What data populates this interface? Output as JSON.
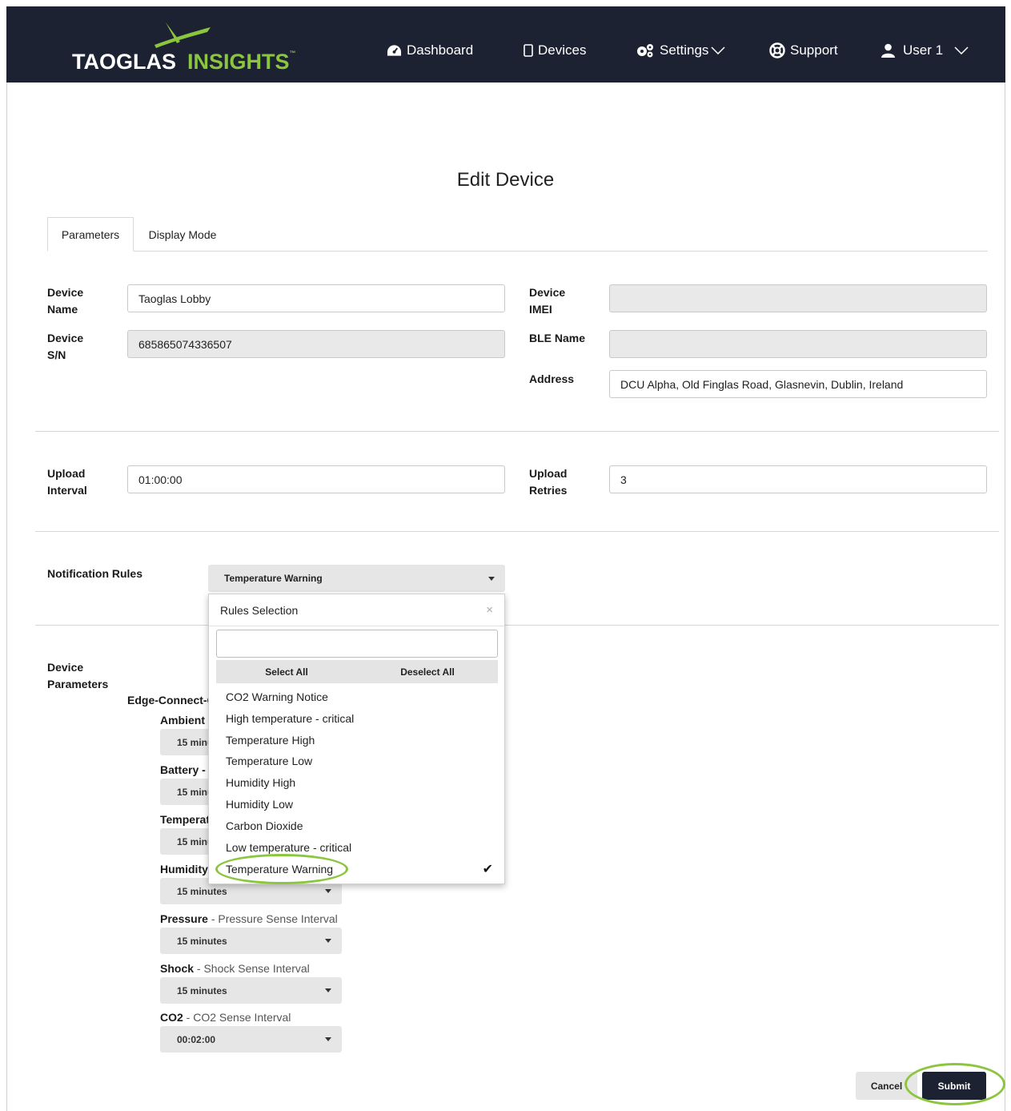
{
  "brand": {
    "name_part1": "TAOGLAS",
    "name_part2": "INSIGHTS",
    "trademark": "™",
    "primary_color": "#1c2231",
    "accent_color": "#8cc63f"
  },
  "nav": {
    "dashboard": "Dashboard",
    "devices": "Devices",
    "settings": "Settings",
    "support": "Support",
    "user": "User 1"
  },
  "page_title": "Edit Device",
  "tabs": {
    "parameters": "Parameters",
    "display_mode": "Display Mode"
  },
  "fields": {
    "device_name_label_1": "Device",
    "device_name_label_2": "Name",
    "device_name_value": "Taoglas Lobby",
    "device_sn_label_1": "Device",
    "device_sn_label_2": "S/N",
    "device_sn_value": "685865074336507",
    "device_imei_label_1": "Device",
    "device_imei_label_2": "IMEI",
    "device_imei_value": "",
    "ble_name_label": "BLE Name",
    "ble_name_value": "",
    "address_label": "Address",
    "address_value": "DCU Alpha, Old Finglas Road, Glasnevin, Dublin, Ireland",
    "upload_interval_label_1": "Upload",
    "upload_interval_label_2": "Interval",
    "upload_interval_value": "01:00:00",
    "upload_retries_label_1": "Upload",
    "upload_retries_label_2": "Retries",
    "upload_retries_value": "3"
  },
  "notification_rules": {
    "label": "Notification Rules",
    "selected": "Temperature Warning",
    "dropdown": {
      "title": "Rules Selection",
      "close": "×",
      "search_value": "",
      "select_all": "Select All",
      "deselect_all": "Deselect All",
      "items": [
        "CO2 Warning Notice",
        "High temperature - critical",
        "Temperature High",
        "Temperature Low",
        "Humidity High",
        "Humidity Low",
        "Carbon Dioxide",
        "Low temperature - critical",
        "Temperature Warning"
      ],
      "checked_item": "Temperature Warning",
      "checkmark": "✔"
    }
  },
  "device_parameters": {
    "label_1": "Device",
    "label_2": "Parameters",
    "group": "Edge-Connect-C",
    "params": [
      {
        "name": "Ambient L",
        "desc": "",
        "value": "15 minu"
      },
      {
        "name": "Battery - L",
        "desc": "",
        "value": "15 minu"
      },
      {
        "name": "Temperat",
        "desc": "",
        "value": "15 minu"
      },
      {
        "name": "Humidity",
        "desc": "",
        "value": "15 minutes"
      },
      {
        "name": "Pressure",
        "desc": " - Pressure Sense Interval",
        "value": "15 minutes"
      },
      {
        "name": "Shock",
        "desc": " - Shock Sense Interval",
        "value": "15 minutes"
      },
      {
        "name": "CO2",
        "desc": " - CO2 Sense Interval",
        "value": "00:02:00"
      }
    ]
  },
  "actions": {
    "cancel": "Cancel",
    "submit": "Submit"
  }
}
